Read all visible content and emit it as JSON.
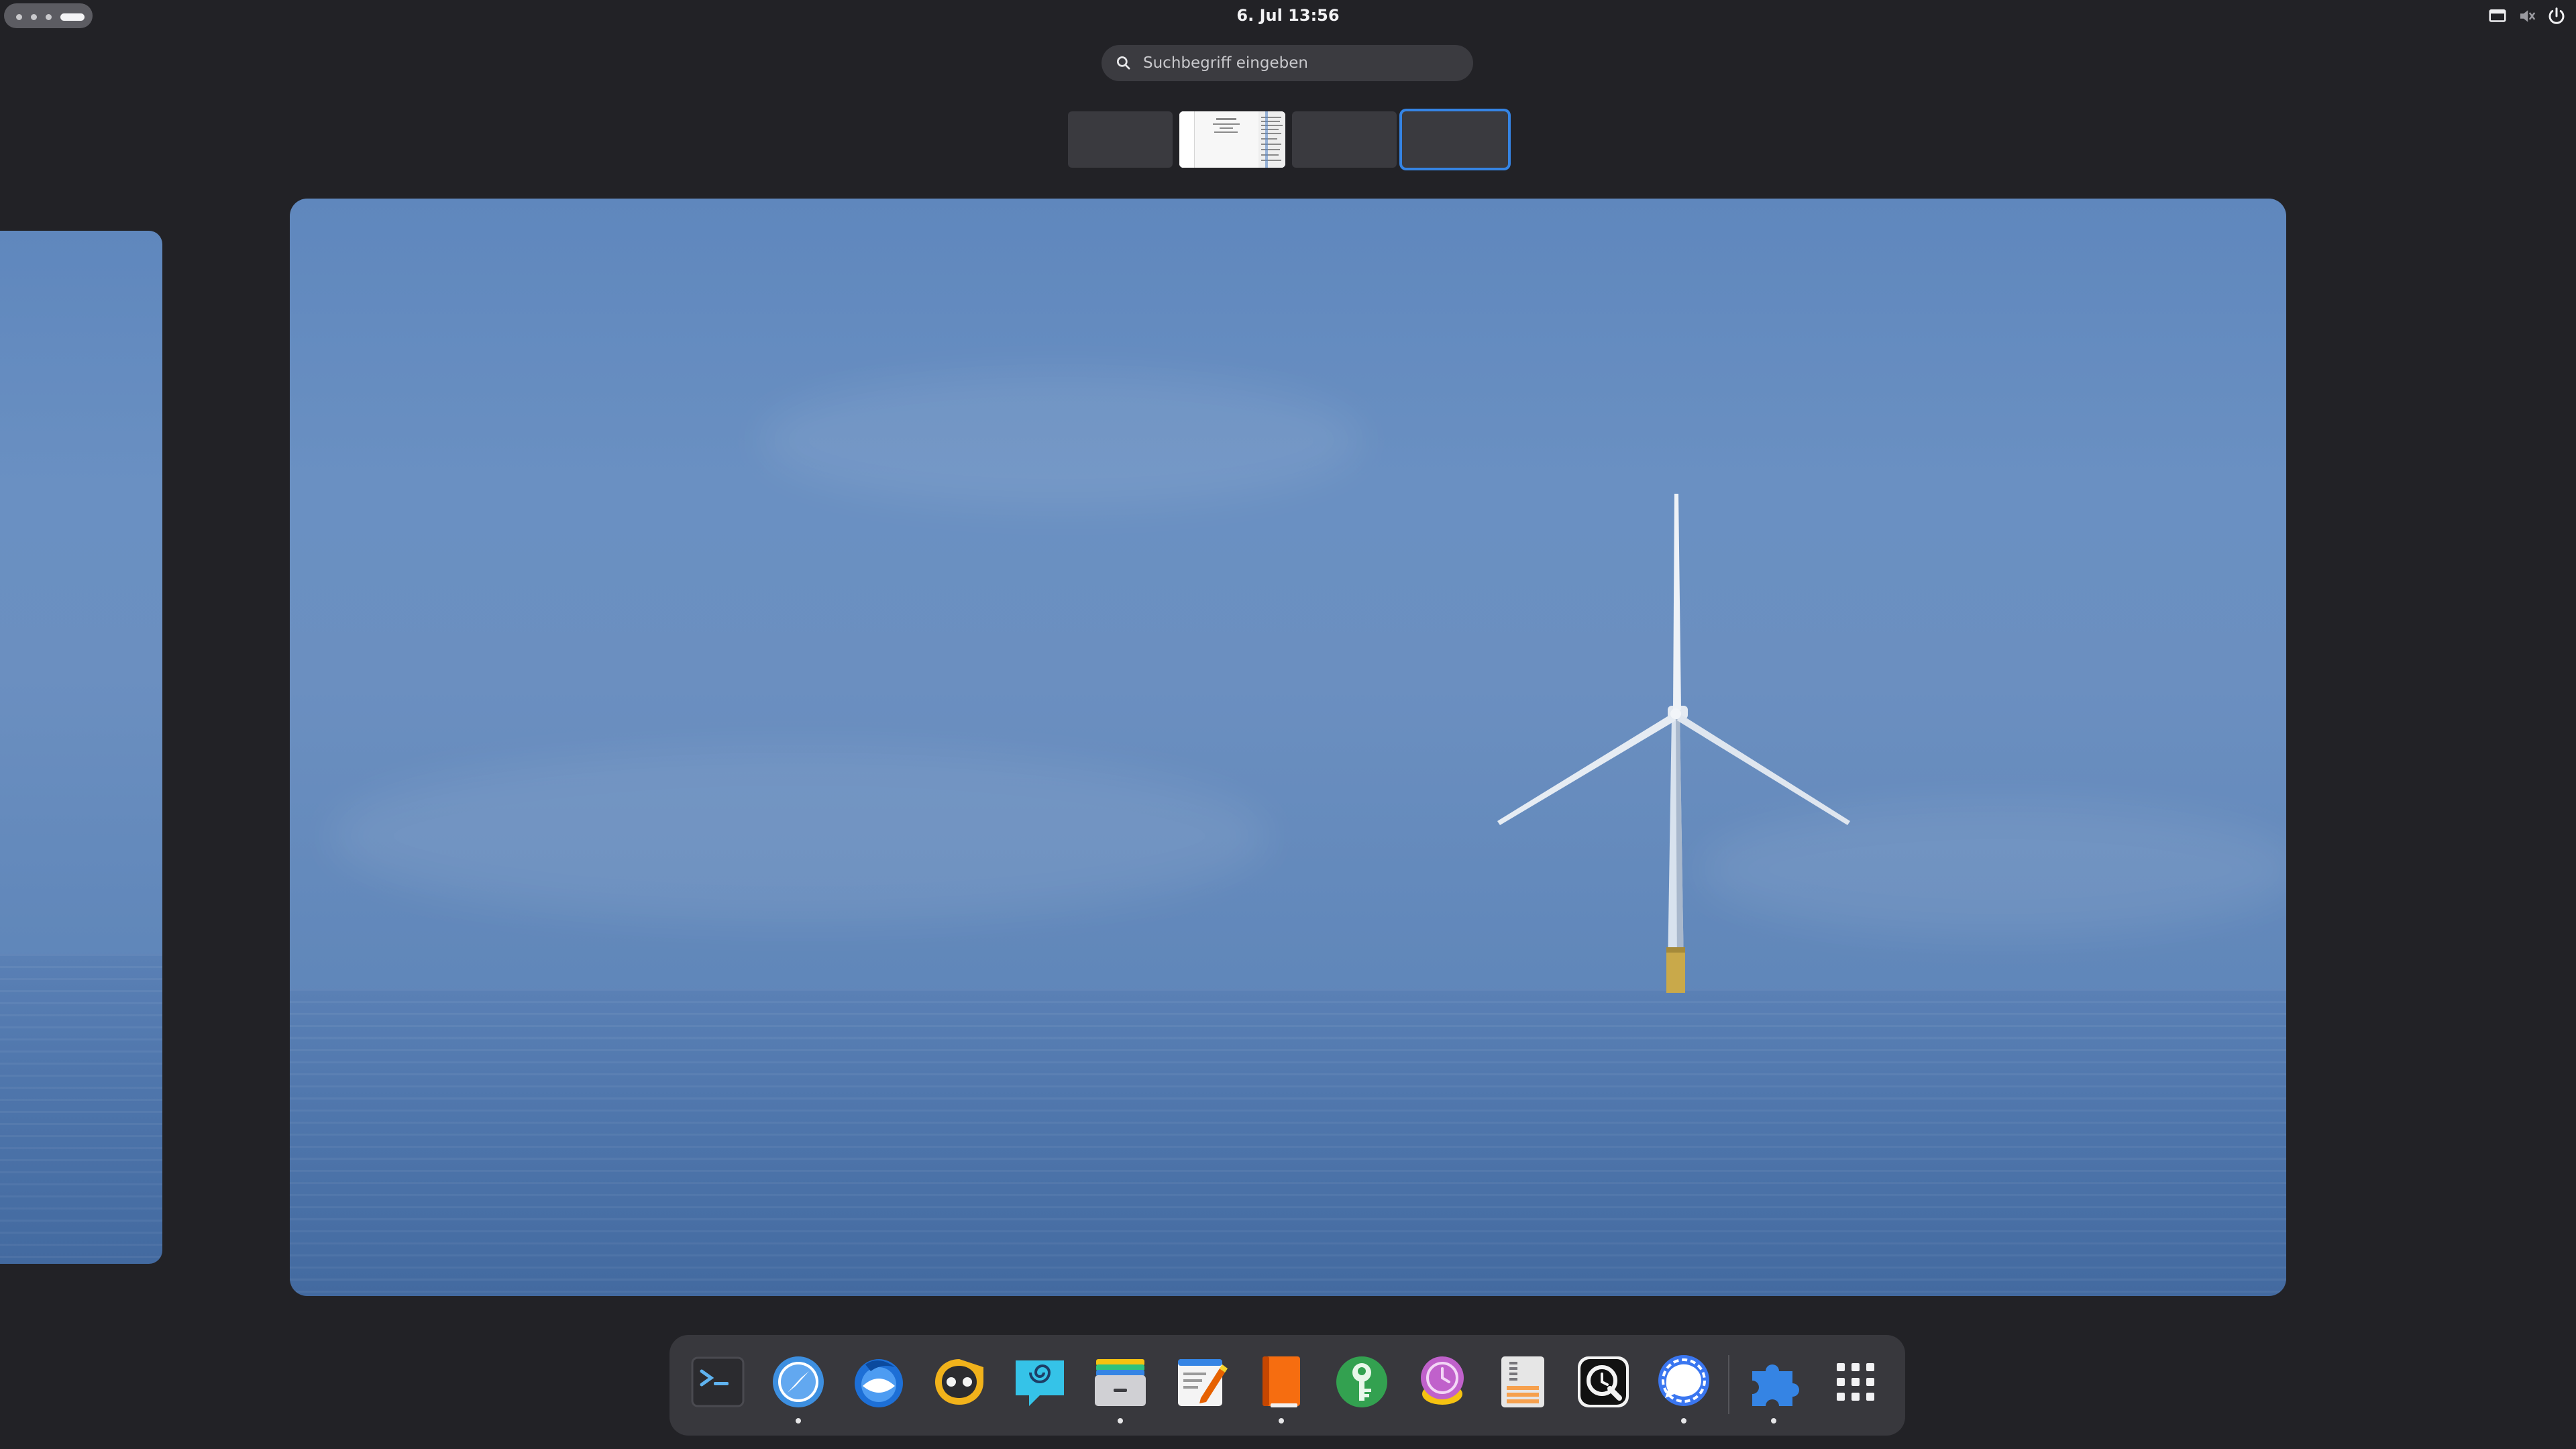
{
  "topbar": {
    "clock": "6. Jul  13:56",
    "tray_icons": [
      "screen-icon",
      "volume-muted-icon",
      "power-icon"
    ]
  },
  "search": {
    "placeholder": "Suchbegriff eingeben"
  },
  "workspaces": [
    {
      "index": 1,
      "active": false
    },
    {
      "index": 2,
      "active": false
    },
    {
      "index": 3,
      "active": false
    },
    {
      "index": 4,
      "active": true
    }
  ],
  "dock": {
    "apps": [
      {
        "icon": "terminal-icon",
        "running": false
      },
      {
        "icon": "web-browser-icon",
        "running": true
      },
      {
        "icon": "thunderbird-icon",
        "running": false
      },
      {
        "icon": "chat-app-icon",
        "running": false
      },
      {
        "icon": "spiral-chat-icon",
        "running": false
      },
      {
        "icon": "files-icon",
        "running": true
      },
      {
        "icon": "text-editor-icon",
        "running": false
      },
      {
        "icon": "notebook-icon",
        "running": true
      },
      {
        "icon": "password-key-icon",
        "running": false
      },
      {
        "icon": "time-tracker-icon",
        "running": false
      },
      {
        "icon": "archive-manager-icon",
        "running": false
      },
      {
        "icon": "search-lens-icon",
        "running": false
      },
      {
        "icon": "signal-icon",
        "running": true
      },
      {
        "icon": "extensions-icon",
        "running": true
      }
    ],
    "show_apps_icon": "app-grid-icon"
  },
  "colors": {
    "background": "#222226",
    "accent": "#3584e4",
    "dock": "#38383d"
  }
}
